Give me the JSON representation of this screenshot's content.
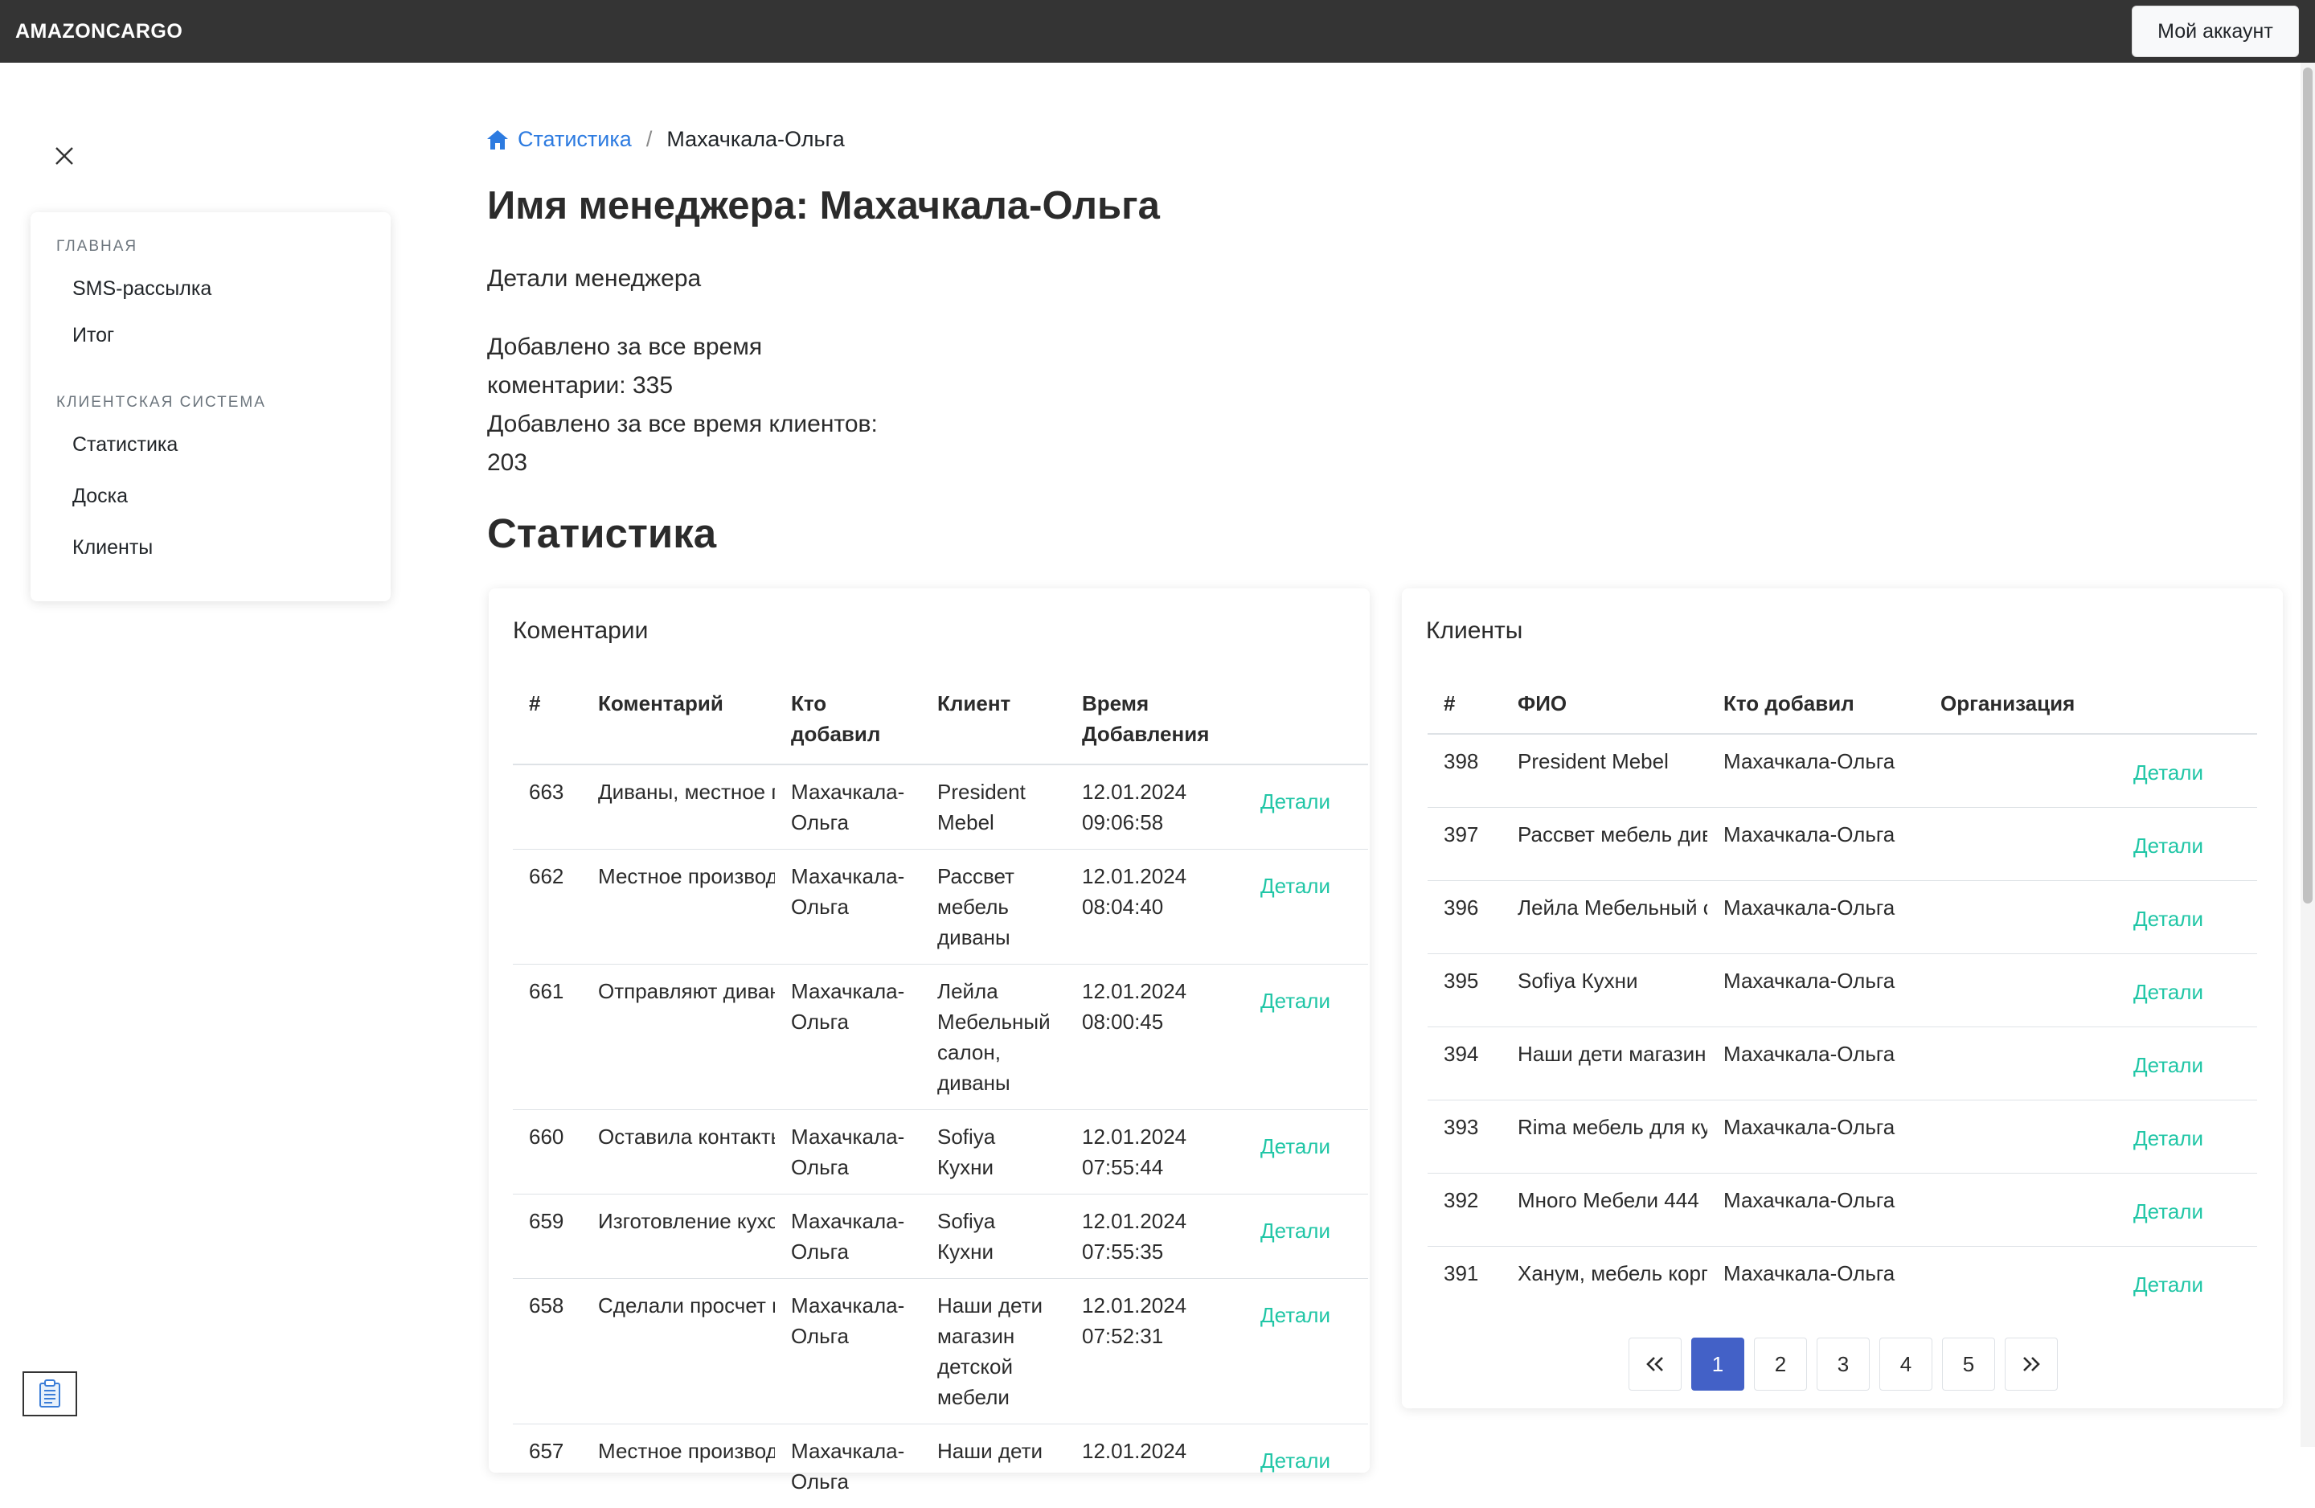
{
  "topbar": {
    "brand": "AMAZONCARGO",
    "account_label": "Мой аккаунт"
  },
  "sidebar": {
    "section1": "ГЛАВНАЯ",
    "items1": [
      {
        "label": "SMS-рассылка"
      },
      {
        "label": "Итог"
      }
    ],
    "section2": "КЛИЕНТСКАЯ СИСТЕМА",
    "items2": [
      {
        "label": "Статистика"
      },
      {
        "label": "Доска"
      },
      {
        "label": "Клиенты"
      }
    ]
  },
  "breadcrumb": {
    "home_label": "Статистика",
    "separator": "/",
    "current": "Махачкала-Ольга"
  },
  "main": {
    "title": "Имя менеджера: Махачкала-Ольга",
    "subtitle": "Детали менеджера",
    "stats_line1": "Добавлено за все время",
    "stats_line2": "коментарии: 335",
    "stats_line3": "Добавлено за все время клиентов:",
    "stats_line4": "203",
    "section_title": "Статистика"
  },
  "comments": {
    "title": "Коментарии",
    "headers": {
      "num": "#",
      "comment": "Коментарий",
      "who_1": "Кто",
      "who_2": "добавил",
      "client": "Клиент",
      "time_1": "Время",
      "time_2": "Добавления"
    },
    "rows": [
      {
        "id": "663",
        "comment": "Диваны, местное производство",
        "who_1": "Махачкала-",
        "who_2": "Ольга",
        "client": [
          "President",
          "Mebel"
        ],
        "date": "12.01.2024",
        "time": "09:06:58",
        "link": "Детали"
      },
      {
        "id": "662",
        "comment": "Местное производство",
        "who_1": "Махачкала-",
        "who_2": "Ольга",
        "client": [
          "Рассвет",
          "мебель",
          "диваны"
        ],
        "date": "12.01.2024",
        "time": "08:04:40",
        "link": "Детали"
      },
      {
        "id": "661",
        "comment": "Отправляют диваны",
        "who_1": "Махачкала-",
        "who_2": "Ольга",
        "client": [
          "Лейла",
          "Мебельный",
          "салон,",
          "диваны"
        ],
        "date": "12.01.2024",
        "time": "08:00:45",
        "link": "Детали"
      },
      {
        "id": "660",
        "comment": "Оставила контакты",
        "who_1": "Махачкала-",
        "who_2": "Ольга",
        "client": [
          "Sofiya",
          "Кухни"
        ],
        "date": "12.01.2024",
        "time": "07:55:44",
        "link": "Детали"
      },
      {
        "id": "659",
        "comment": "Изготовление кухонь",
        "who_1": "Махачкала-",
        "who_2": "Ольга",
        "client": [
          "Sofiya",
          "Кухни"
        ],
        "date": "12.01.2024",
        "time": "07:55:35",
        "link": "Детали"
      },
      {
        "id": "658",
        "comment": "Сделали просчет по",
        "who_1": "Махачкала-",
        "who_2": "Ольга",
        "client": [
          "Наши дети",
          "магазин",
          "детской",
          "мебели"
        ],
        "date": "12.01.2024",
        "time": "07:52:31",
        "link": "Детали"
      },
      {
        "id": "657",
        "comment": "Местное производство",
        "who_1": "Махачкала-",
        "who_2": "Ольга",
        "client": [
          "Наши дети"
        ],
        "date": "12.01.2024",
        "time": "",
        "link": "Детали"
      }
    ]
  },
  "clients": {
    "title": "Клиенты",
    "headers": {
      "num": "#",
      "name": "ФИО",
      "who": "Кто добавил",
      "org": "Организация"
    },
    "rows": [
      {
        "id": "398",
        "name": "President Mebel",
        "who": "Махачкала-Ольга",
        "org": "",
        "link": "Детали"
      },
      {
        "id": "397",
        "name": "Рассвет мебель диваны",
        "who": "Махачкала-Ольга",
        "org": "",
        "link": "Детали"
      },
      {
        "id": "396",
        "name": "Лейла Мебельный салон",
        "who": "Махачкала-Ольга",
        "org": "",
        "link": "Детали"
      },
      {
        "id": "395",
        "name": "Sofiya Кухни",
        "who": "Махачкала-Ольга",
        "org": "",
        "link": "Детали"
      },
      {
        "id": "394",
        "name": "Наши дети магазин детской мебели",
        "who": "Махачкала-Ольга",
        "org": "",
        "link": "Детали"
      },
      {
        "id": "393",
        "name": "Rima мебель для кухни",
        "who": "Махачкала-Ольга",
        "org": "",
        "link": "Детали"
      },
      {
        "id": "392",
        "name": "Много Мебели 444",
        "who": "Махачкала-Ольга",
        "org": "",
        "link": "Детали"
      },
      {
        "id": "391",
        "name": "Ханум, мебель корпусная",
        "who": "Махачкала-Ольга",
        "org": "",
        "link": "Детали"
      }
    ],
    "pagination": {
      "first": "«",
      "pages": [
        "1",
        "2",
        "3",
        "4",
        "5"
      ],
      "last": "»",
      "active": "1"
    }
  },
  "colors": {
    "topbar": "#343434",
    "link": "#2d7be0",
    "detail_link": "#20c6a6",
    "active_page": "#4361c7"
  },
  "icons": {
    "home": "home-icon",
    "close": "close-icon",
    "notes": "clipboard-icon"
  }
}
